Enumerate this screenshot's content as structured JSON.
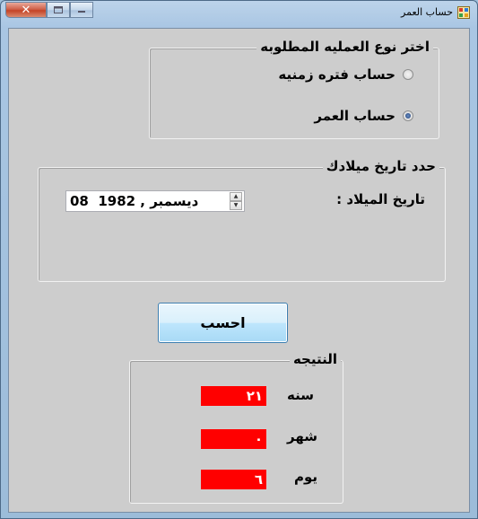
{
  "window": {
    "title": "حساب العمر",
    "close_glyph": "✕"
  },
  "operation_group": {
    "legend": "اختر نوع العمليه المطلوبه",
    "options": [
      {
        "label": "حساب فتره زمنيه",
        "checked": false
      },
      {
        "label": "حساب العمر",
        "checked": true
      }
    ]
  },
  "birth_group": {
    "legend": "حدد  تاريخ ميلادك",
    "label": "تاريخ الميلاد :",
    "date_value": "08  ديسمبر , 1982"
  },
  "calculate_button": {
    "label": "احسب"
  },
  "result_group": {
    "legend": "النتيجه",
    "rows": [
      {
        "label": "سنه",
        "value": "٢١"
      },
      {
        "label": "شهر",
        "value": "٠"
      },
      {
        "label": "يوم",
        "value": "٦"
      }
    ]
  },
  "colors": {
    "result_bg": "#ff0000",
    "result_text": "#ffffff",
    "client_bg": "#cdcdcd"
  }
}
